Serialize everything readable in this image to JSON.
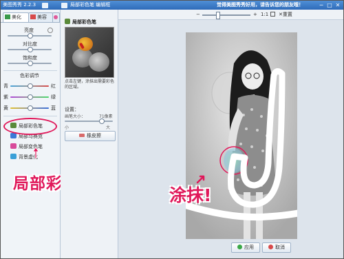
{
  "titlebar": {
    "app_title": "美图秀秀 2.2.3",
    "panel_title": "局部彩色笔 编辑框",
    "promo": "觉得美图秀秀好用，请告诉您的朋友哦！"
  },
  "window_controls": {
    "minimize": "─",
    "maximize": "□",
    "close": "✕"
  },
  "sidebar": {
    "tabs": [
      {
        "label": "美化",
        "icon": "beautify-icon"
      },
      {
        "label": "美容",
        "icon": "makeup-icon"
      }
    ],
    "sliders": {
      "brightness": {
        "label": "亮度",
        "value": 0.5
      },
      "contrast": {
        "label": "对比度",
        "value": 0.5
      },
      "saturation": {
        "label": "饱和度",
        "value": 0.5
      }
    },
    "color_adjust": {
      "title": "色彩调节",
      "channels": [
        {
          "left": "青",
          "right": "红",
          "value": 0.5
        },
        {
          "left": "紫",
          "right": "绿",
          "value": 0.5
        },
        {
          "left": "黄",
          "right": "蓝",
          "value": 0.5
        }
      ]
    },
    "tools": [
      {
        "label": "局部彩色笔",
        "icon": "color-pen-icon",
        "color": "#5a8a3a"
      },
      {
        "label": "局部马赛克",
        "icon": "mosaic-icon",
        "color": "#3a7ad8"
      },
      {
        "label": "局部变色笔",
        "icon": "recolor-pen-icon",
        "color": "#d84a9a"
      },
      {
        "label": "背景虚化",
        "icon": "blur-bg-icon",
        "color": "#3aa0d8"
      }
    ]
  },
  "annotations": {
    "tool_name": "局部彩色笔",
    "smear": "涂抹!"
  },
  "panel": {
    "title": "局部彩色笔",
    "description": "点击左键，涂抹出需要彩色的区域。",
    "settings_label": "设置：",
    "brush_size_label": "画笔大小：",
    "brush_size_value": "71像素",
    "brush_size_fraction": 0.75,
    "small_label": "小",
    "big_label": "大",
    "eraser_label": "橡皮擦"
  },
  "toolbar": {
    "zoom_minus": "−",
    "zoom_plus": "+",
    "ratio": "1:1",
    "reset": "重置",
    "zoom_level": 0.3
  },
  "actions": {
    "apply": "应用",
    "cancel": "取消"
  },
  "colors": {
    "accent": "#e0185a",
    "title_bar": "#2e6bb9",
    "apply_icon": "#3aa847",
    "cancel_icon": "#d84a4a"
  }
}
